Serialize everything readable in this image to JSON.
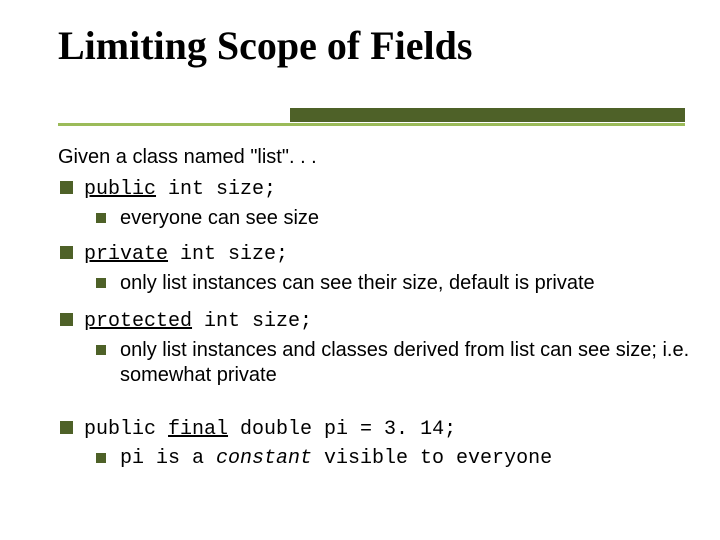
{
  "title": "Limiting Scope of Fields",
  "intro": "Given a class named \"list\". . .",
  "items": [
    {
      "keyword": "public",
      "rest": " int size;",
      "desc": "everyone can see size"
    },
    {
      "keyword": "private",
      "rest": " int size;",
      "desc": "only list instances can see their size, default is private"
    },
    {
      "keyword": "protected",
      "rest": " int size;",
      "desc": "only list instances and classes derived from list can see size; i.e. somewhat private"
    }
  ],
  "final_item": {
    "prefix": "public ",
    "keyword": "final",
    "rest": " double pi = 3. 14;",
    "desc_before": "pi is a ",
    "desc_em": "constant",
    "desc_after": " visible to everyone"
  }
}
